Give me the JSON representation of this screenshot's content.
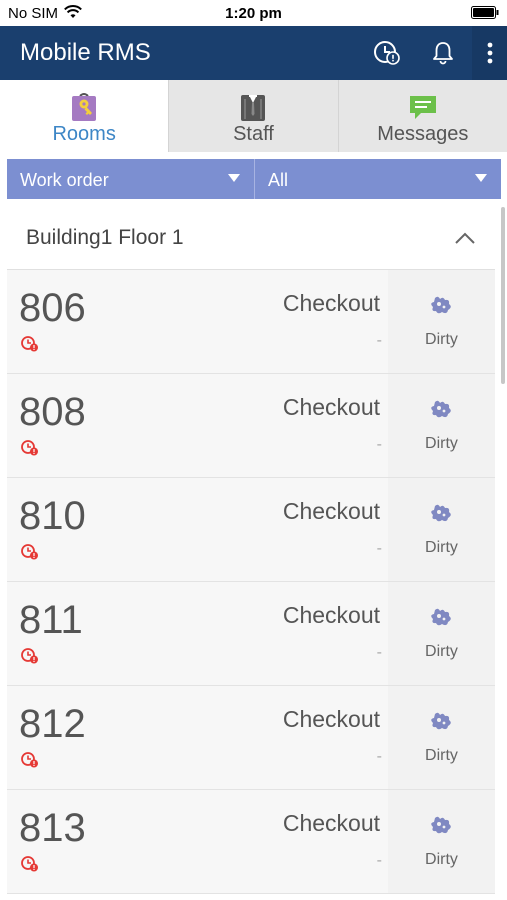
{
  "status_bar": {
    "carrier": "No SIM",
    "time": "1:20 pm"
  },
  "app_bar": {
    "title": "Mobile RMS",
    "icons": [
      "clock-alert-icon",
      "bell-icon",
      "more-vertical-icon"
    ]
  },
  "tabs": [
    {
      "label": "Rooms",
      "icon": "rooms-key-icon",
      "active": true
    },
    {
      "label": "Staff",
      "icon": "staff-suit-icon",
      "active": false
    },
    {
      "label": "Messages",
      "icon": "messages-chat-icon",
      "active": false
    }
  ],
  "filters": {
    "work_order": "Work order",
    "scope": "All"
  },
  "section": {
    "title": "Building1 Floor 1"
  },
  "rooms": [
    {
      "number": "806",
      "status": "Checkout",
      "detail": "-",
      "clean_status": "Dirty"
    },
    {
      "number": "808",
      "status": "Checkout",
      "detail": "-",
      "clean_status": "Dirty"
    },
    {
      "number": "810",
      "status": "Checkout",
      "detail": "-",
      "clean_status": "Dirty"
    },
    {
      "number": "811",
      "status": "Checkout",
      "detail": "-",
      "clean_status": "Dirty"
    },
    {
      "number": "812",
      "status": "Checkout",
      "detail": "-",
      "clean_status": "Dirty"
    },
    {
      "number": "813",
      "status": "Checkout",
      "detail": "-",
      "clean_status": "Dirty"
    }
  ],
  "colors": {
    "app_bar": "#1a3f6e",
    "tab_active_text": "#3d86c6",
    "filter_bar": "#7c8fd1",
    "alert_red": "#e53935",
    "dirty_icon": "#8089c2"
  }
}
